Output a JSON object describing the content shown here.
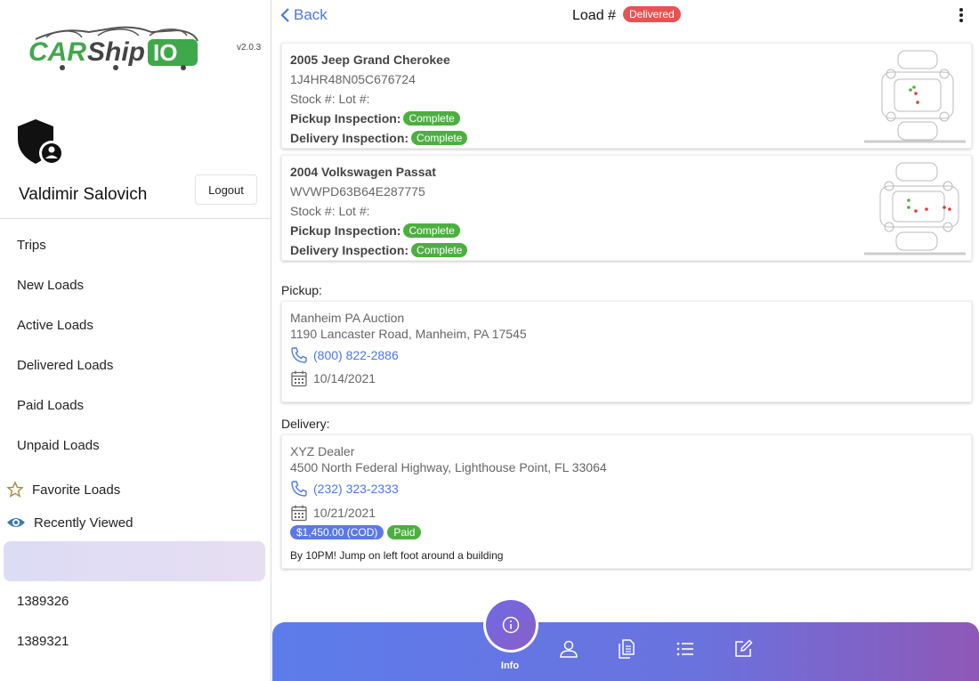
{
  "app": {
    "logo_text": "CARShipIO",
    "version": "v2.0.3"
  },
  "user": {
    "name": "Valdimir Salovich",
    "logout_label": "Logout"
  },
  "sidebar": {
    "items": [
      {
        "label": "Trips"
      },
      {
        "label": "New Loads"
      },
      {
        "label": "Active Loads"
      },
      {
        "label": "Delivered Loads"
      },
      {
        "label": "Paid Loads"
      },
      {
        "label": "Unpaid Loads"
      }
    ],
    "favorite_label": "Favorite Loads",
    "recent_label": "Recently Viewed",
    "recent_items": [
      {
        "label": "1389326"
      },
      {
        "label": "1389321"
      }
    ]
  },
  "header": {
    "back_label": "Back",
    "title": "Load #",
    "status": "Delivered"
  },
  "vehicles": [
    {
      "title": "2005 Jeep Grand Cherokee",
      "vin": "1J4HR48N05C676724",
      "stock": "Stock #: Lot #:",
      "pickup_label": "Pickup Inspection:",
      "pickup_status": "Complete",
      "delivery_label": "Delivery Inspection:",
      "delivery_status": "Complete"
    },
    {
      "title": "2004 Volkswagen Passat",
      "vin": "WVWPD63B64E287775",
      "stock": "Stock #: Lot #:",
      "pickup_label": "Pickup Inspection:",
      "pickup_status": "Complete",
      "delivery_label": "Delivery Inspection:",
      "delivery_status": "Complete"
    }
  ],
  "pickup": {
    "section_label": "Pickup:",
    "name": "Manheim PA Auction",
    "address": "1190 Lancaster Road, Manheim, PA 17545",
    "phone": "(800) 822-2886",
    "date": "10/14/2021"
  },
  "delivery": {
    "section_label": "Delivery:",
    "name": "XYZ Dealer",
    "address": "4500 North Federal Highway, Lighthouse Point, FL 33064",
    "phone": "(232) 323-2333",
    "date": "10/21/2021",
    "price": "$1,450.00 (COD)",
    "paid": "Paid",
    "note": "By 10PM! Jump on left foot around a building"
  },
  "bottom_nav": {
    "active_label": "Info",
    "icons": [
      "info-icon",
      "person-icon",
      "documents-icon",
      "list-icon",
      "edit-icon"
    ]
  },
  "colors": {
    "accent": "#4a76e8",
    "delivered_badge": "#e65353",
    "complete_badge": "#4caf40",
    "price_badge": "#5b78e6",
    "bar_gradient_start": "#5d7ceb",
    "bar_gradient_end": "#8e58b7"
  }
}
